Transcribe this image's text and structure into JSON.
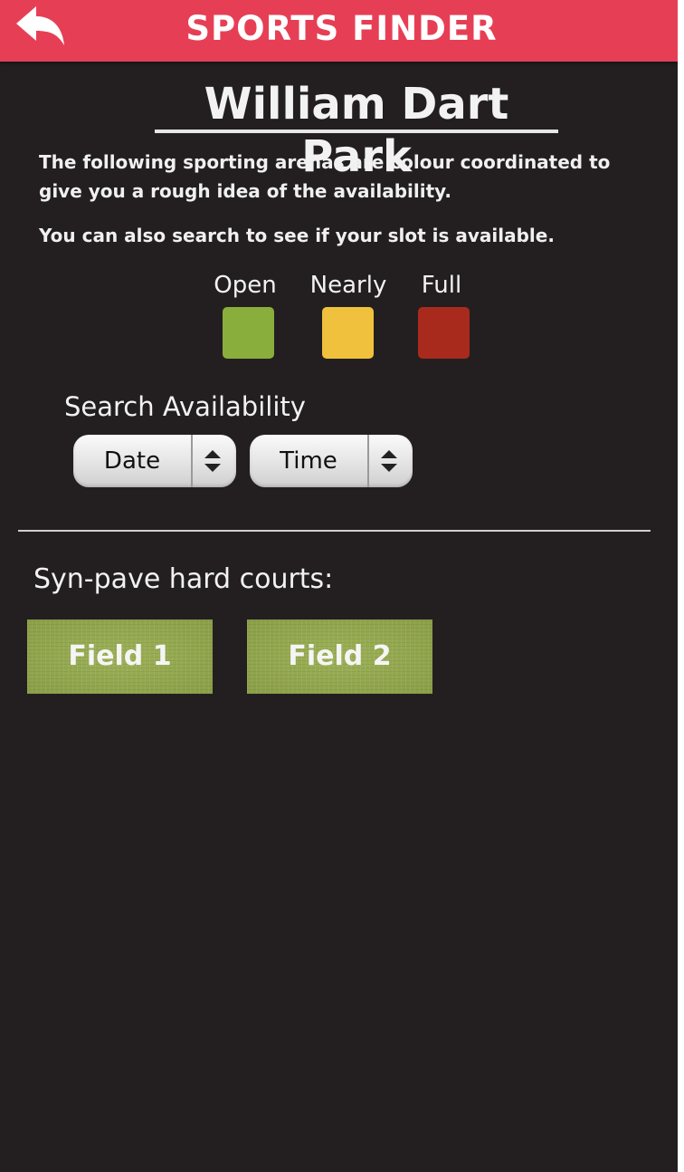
{
  "header": {
    "title": "SPORTS FINDER",
    "back_icon": "back-arrow-icon",
    "color": "#e63f55"
  },
  "park": {
    "name": "William Dart Park"
  },
  "intro": {
    "text1": "The following sporting arenas are colour coordinated to give you a rough idea of the availability.",
    "text2": "You can also search to see if your slot is available."
  },
  "legend": [
    {
      "label": "Open",
      "color": "#8aae3c"
    },
    {
      "label": "Nearly",
      "color": "#f0c13c"
    },
    {
      "label": "Full",
      "color": "#a82a1c"
    }
  ],
  "search": {
    "label": "Search Availability",
    "date_picker": "Date",
    "time_picker": "Time"
  },
  "courts": {
    "section_label": "Syn-pave hard courts:",
    "fields": [
      {
        "label": "Field 1",
        "status": "Open"
      },
      {
        "label": "Field 2",
        "status": "Open"
      }
    ]
  }
}
